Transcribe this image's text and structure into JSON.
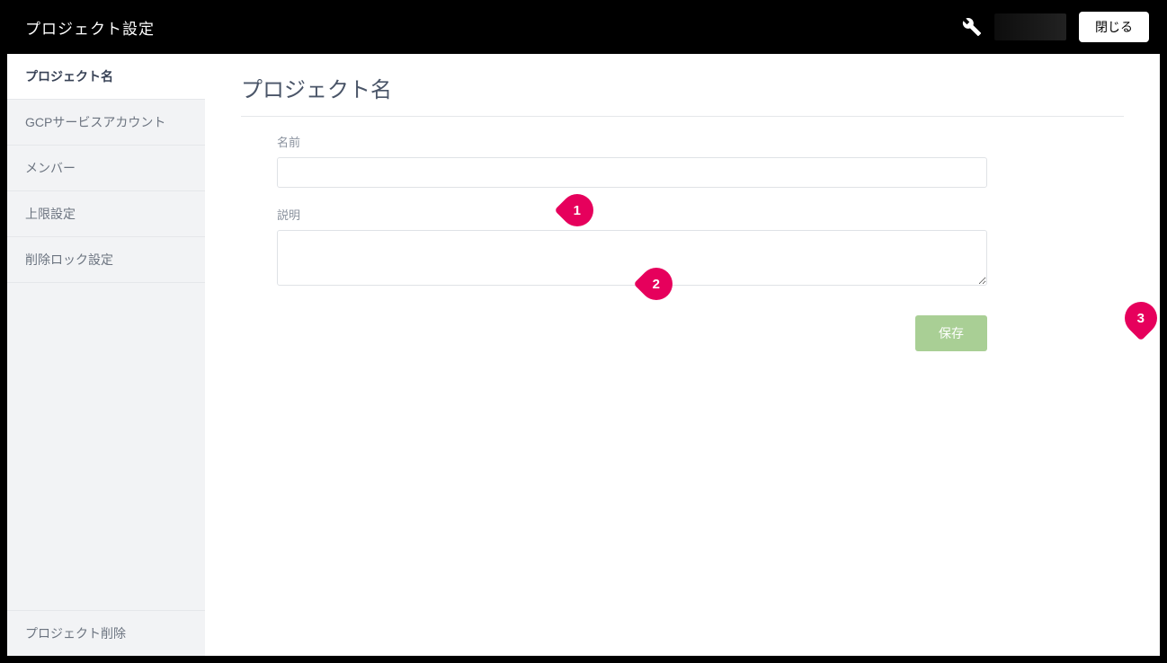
{
  "header": {
    "title": "プロジェクト設定",
    "close_label": "閉じる"
  },
  "sidebar": {
    "items": [
      {
        "label": "プロジェクト名",
        "active": true
      },
      {
        "label": "GCPサービスアカウント",
        "active": false
      },
      {
        "label": "メンバー",
        "active": false
      },
      {
        "label": "上限設定",
        "active": false
      },
      {
        "label": "削除ロック設定",
        "active": false
      }
    ],
    "delete_label": "プロジェクト削除"
  },
  "content": {
    "title": "プロジェクト名",
    "name_label": "名前",
    "name_value": "",
    "description_label": "説明",
    "description_value": "",
    "save_label": "保存"
  },
  "callouts": {
    "c1": "1",
    "c2": "2",
    "c3": "3"
  }
}
